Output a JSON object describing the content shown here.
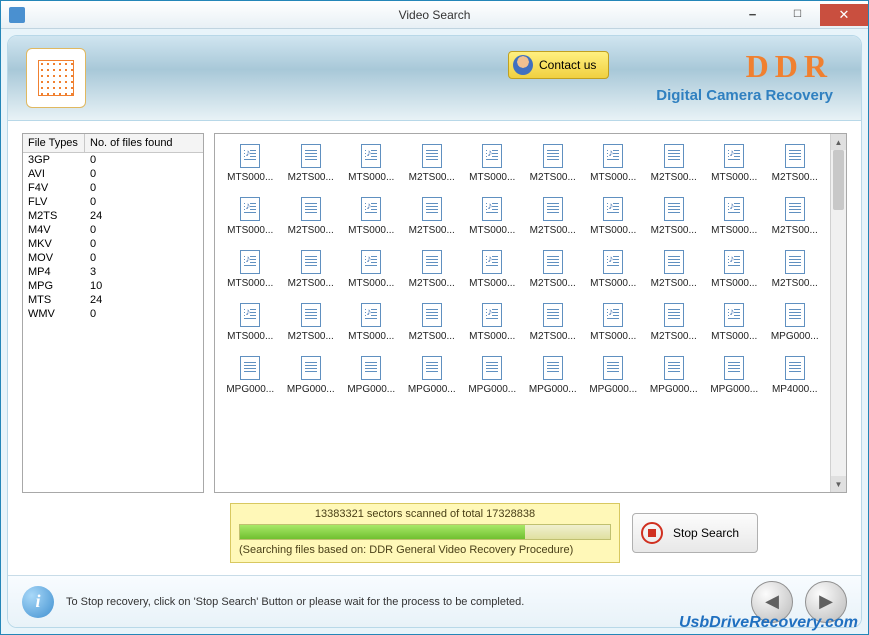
{
  "window": {
    "title": "Video Search"
  },
  "banner": {
    "contact_label": "Contact us",
    "brand_top": "DDR",
    "brand_sub": "Digital Camera Recovery"
  },
  "types_table": {
    "col_type": "File Types",
    "col_count": "No. of files found",
    "rows": [
      {
        "type": "3GP",
        "count": "0"
      },
      {
        "type": "AVI",
        "count": "0"
      },
      {
        "type": "F4V",
        "count": "0"
      },
      {
        "type": "FLV",
        "count": "0"
      },
      {
        "type": "M2TS",
        "count": "24"
      },
      {
        "type": "M4V",
        "count": "0"
      },
      {
        "type": "MKV",
        "count": "0"
      },
      {
        "type": "MOV",
        "count": "0"
      },
      {
        "type": "MP4",
        "count": "3"
      },
      {
        "type": "MPG",
        "count": "10"
      },
      {
        "type": "MTS",
        "count": "24"
      },
      {
        "type": "WMV",
        "count": "0"
      }
    ]
  },
  "file_grid": [
    [
      "MTS000...",
      "M2TS00...",
      "MTS000...",
      "M2TS00...",
      "MTS000...",
      "M2TS00...",
      "MTS000...",
      "M2TS00...",
      "MTS000...",
      "M2TS00..."
    ],
    [
      "MTS000...",
      "M2TS00...",
      "MTS000...",
      "M2TS00...",
      "MTS000...",
      "M2TS00...",
      "MTS000...",
      "M2TS00...",
      "MTS000...",
      "M2TS00..."
    ],
    [
      "MTS000...",
      "M2TS00...",
      "MTS000...",
      "M2TS00...",
      "MTS000...",
      "M2TS00...",
      "MTS000...",
      "M2TS00...",
      "MTS000...",
      "M2TS00..."
    ],
    [
      "MTS000...",
      "M2TS00...",
      "MTS000...",
      "M2TS00...",
      "MTS000...",
      "M2TS00...",
      "MTS000...",
      "M2TS00...",
      "MTS000...",
      "MPG000..."
    ],
    [
      "MPG000...",
      "MPG000...",
      "MPG000...",
      "MPG000...",
      "MPG000...",
      "MPG000...",
      "MPG000...",
      "MPG000...",
      "MPG000...",
      "MP4000..."
    ]
  ],
  "progress": {
    "line1": "13383321 sectors scanned of total 17328838",
    "line2": "(Searching files based on:  DDR General Video Recovery Procedure)"
  },
  "stop_label": "Stop Search",
  "footer_hint": "To Stop recovery, click on 'Stop Search' Button or please wait for the process to be completed.",
  "brand_link": "UsbDriveRecovery.com"
}
